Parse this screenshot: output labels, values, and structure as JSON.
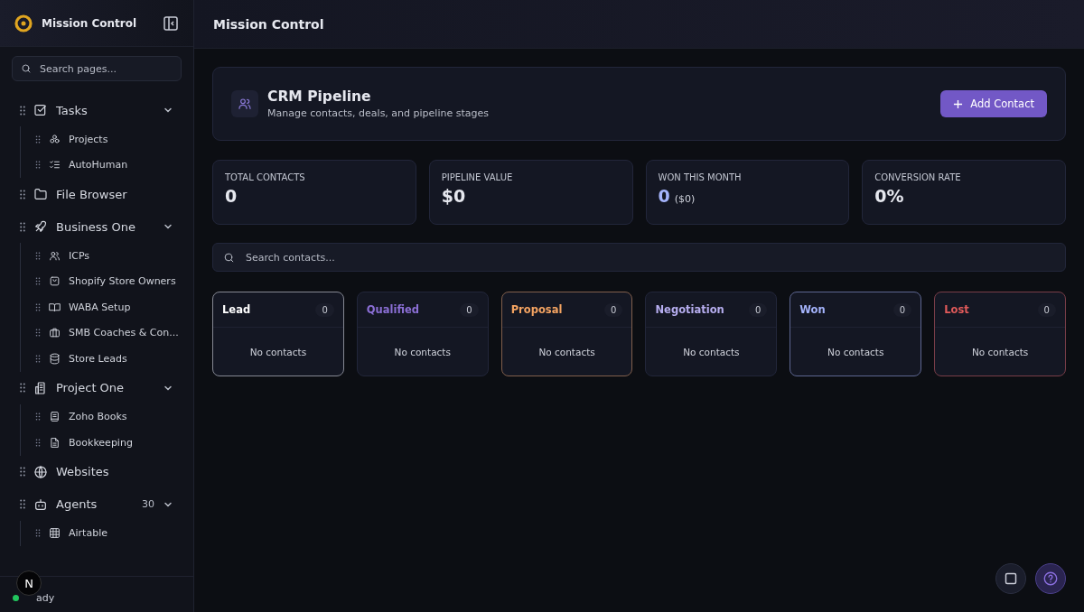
{
  "app": {
    "name": "Mission Control"
  },
  "sidebar": {
    "search": {
      "placeholder": "Search pages..."
    },
    "items": [
      {
        "label": "Tasks",
        "expanded": true,
        "children": [
          {
            "label": "Projects"
          },
          {
            "label": "AutoHuman"
          }
        ]
      },
      {
        "label": "File Browser"
      },
      {
        "label": "Business One",
        "expanded": true,
        "children": [
          {
            "label": "ICPs"
          },
          {
            "label": "Shopify Store Owners"
          },
          {
            "label": "WABA Setup"
          },
          {
            "label": "SMB Coaches & Con..."
          },
          {
            "label": "Store Leads"
          }
        ]
      },
      {
        "label": "Project One",
        "expanded": true,
        "children": [
          {
            "label": "Zoho Books"
          },
          {
            "label": "Bookkeeping"
          }
        ]
      },
      {
        "label": "Websites"
      },
      {
        "label": "Agents",
        "count": "30",
        "expanded": true,
        "children": [
          {
            "label": "Airtable"
          }
        ]
      }
    ],
    "status": {
      "text": "ady",
      "color": "#22c55e",
      "badge": "N"
    }
  },
  "header": {
    "title": "Mission Control"
  },
  "page": {
    "title": "CRM Pipeline",
    "subtitle": "Manage contacts, deals, and pipeline stages",
    "button": "Add Contact"
  },
  "stats": [
    {
      "label": "TOTAL CONTACTS",
      "value": "0"
    },
    {
      "label": "PIPELINE VALUE",
      "value": "$0"
    },
    {
      "label": "WON THIS MONTH",
      "value": "0",
      "extra": "($0)",
      "color": "#a5b4fc"
    },
    {
      "label": "CONVERSION RATE",
      "value": "0%"
    }
  ],
  "contact_search": {
    "placeholder": "Search contacts..."
  },
  "stages": [
    {
      "name": "Lead",
      "count": "0",
      "color": "#ffffff",
      "outlined": true,
      "empty_text": "No contacts"
    },
    {
      "name": "Qualified",
      "count": "0",
      "color": "#8b6fd6",
      "outlined": false,
      "empty_text": "No contacts"
    },
    {
      "name": "Proposal",
      "count": "0",
      "color": "#f5a462",
      "outlined": true,
      "empty_text": "No contacts"
    },
    {
      "name": "Negotiation",
      "count": "0",
      "color": "#b7aef0",
      "outlined": false,
      "empty_text": "No contacts"
    },
    {
      "name": "Won",
      "count": "0",
      "color": "#a5b4fc",
      "outlined": true,
      "empty_text": "No contacts"
    },
    {
      "name": "Lost",
      "count": "0",
      "color": "#e05a5a",
      "outlined": true,
      "empty_text": "No contacts"
    }
  ]
}
